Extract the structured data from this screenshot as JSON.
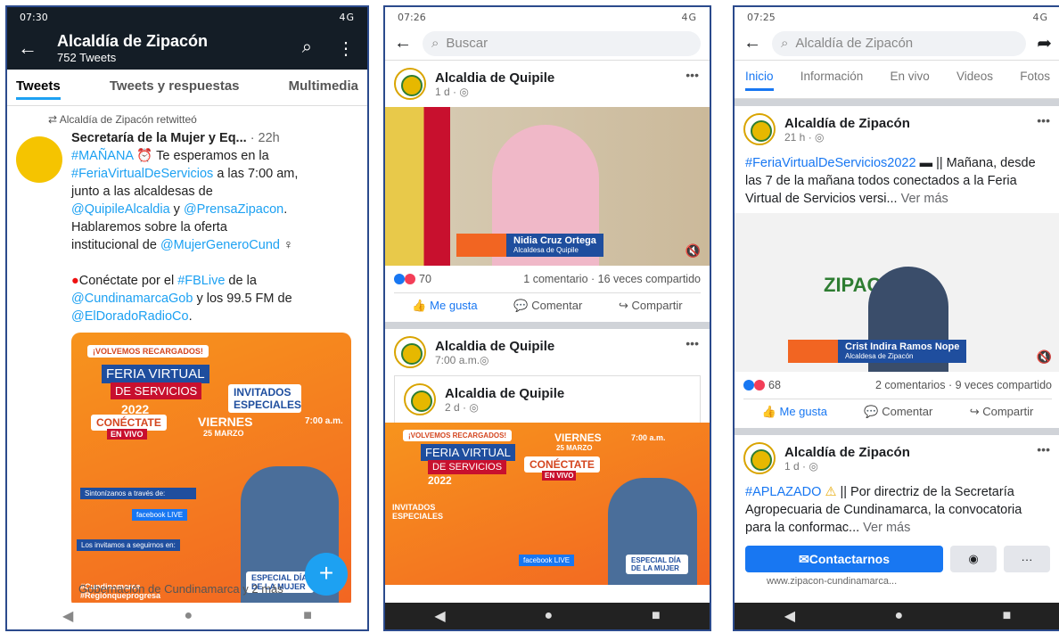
{
  "p1": {
    "status": {
      "time": "07:30",
      "icons_right": "4G"
    },
    "title": "Alcaldía de Zipacón",
    "subtitle": "752 Tweets",
    "tabs": [
      "Tweets",
      "Tweets y respuestas",
      "Multimedia"
    ],
    "retweet_label": "Alcaldía de Zipacón retwitteó",
    "tweet": {
      "author": "Secretaría de la Mujer y Eq...",
      "time": "· 22h",
      "l1_a": "#MAÑANA",
      "l1_b": " Te esperamos en la",
      "l2_a": "#FeriaVirtualDeServicios",
      "l2_b": " a las 7:00 am,",
      "l3": "junto a las alcaldesas de",
      "l4_a": "@QuipileAlcaldia",
      "l4_b": " y ",
      "l4_c": "@PrensaZipacon",
      "l4_d": ".",
      "l5": "Hablaremos sobre la oferta",
      "l6_a": "institucional de ",
      "l6_b": "@MujerGeneroCund",
      "l7_a": "Conéctate por el ",
      "l7_b": "#FBLive",
      "l7_c": " de la",
      "l8_a": "@CundinamarcaGob",
      "l8_b": " y los 99.5 FM de",
      "l9": "@ElDoradoRadioCo",
      "l9_b": "."
    },
    "poster": {
      "banner": "¡VOLVEMOS RECARGADOS!",
      "title1": "FERIA VIRTUAL",
      "title2": "DE SERVICIOS",
      "year": "2022",
      "guests": "INVITADOS ESPECIALES",
      "connect": "CONÉCTATE",
      "live": "EN VIVO",
      "day": "VIERNES",
      "date": "25 MARZO",
      "time": "7:00 a.m.",
      "sintonizanos": "Sintonízanos a través de:",
      "fb": "facebook LIVE",
      "invite": "Los invitamos a seguirnos en:",
      "hashtags": "#Cundinamarca #Regiónqueprogresa",
      "special": "ESPECIAL DÍA DE LA MUJER"
    },
    "fab": "+",
    "footer": "Gobernación de Cundinamarca y 2 más"
  },
  "p2": {
    "status": {
      "time": "07:26",
      "icons_right": "4G"
    },
    "search_placeholder": "Buscar",
    "post1": {
      "name": "Alcaldia de Quipile",
      "time": "1 d · ",
      "dots": "•••",
      "lower_name": "Nidia Cruz Ortega",
      "lower_role": "Alcaldesa de Quipile",
      "reactions": "70",
      "stats": "1 comentario · 16 veces compartido",
      "like": "Me gusta",
      "comment": "Comentar",
      "share": "Compartir"
    },
    "post2": {
      "name": "Alcaldia de Quipile",
      "time": "7:00 a.m.",
      "dots": "•••",
      "inner_name": "Alcaldia de Quipile",
      "inner_time": "2 d · ",
      "banner": "¡VOLVEMOS RECARGADOS!",
      "title1": "FERIA VIRTUAL",
      "title2": "DE SERVICIOS",
      "year": "2022",
      "day": "VIERNES",
      "date": "25 MARZO",
      "connect": "CONÉCTATE",
      "live": "EN VIVO",
      "guests": "INVITADOS ESPECIALES",
      "special": "ESPECIAL DÍA DE LA MUJER",
      "fb": "facebook LIVE"
    }
  },
  "p3": {
    "status": {
      "time": "07:25",
      "icons_right": "4G"
    },
    "search_value": "Alcaldía de Zipacón",
    "tabs": [
      "Inicio",
      "Información",
      "En vivo",
      "Videos",
      "Fotos"
    ],
    "post1": {
      "name": "Alcaldía de Zipacón",
      "time": "21 h · ",
      "dots": "•••",
      "text_a": "#FeriaVirtualDeServicios2022",
      "text_b": " || Mañana, desde las 7 de la mañana todos conectados a la Feria Virtual de Servicios versi... ",
      "more": "Ver más",
      "lower_name": "Crist Indira Ramos Nope",
      "lower_role": "Alcaldesa de Zipacón",
      "sign": "ZIPACÓN",
      "reactions": "68",
      "stats": "2 comentarios · 9 veces compartido",
      "like": "Me gusta",
      "comment": "Comentar",
      "share": "Compartir"
    },
    "post2": {
      "name": "Alcaldía de Zipacón",
      "time": "1 d · ",
      "dots": "•••",
      "text_a": "#APLAZADO",
      "text_b": " || Por directriz de la Secretaría Agropecuaria de Cundinamarca, la convocatoria para la conformac... ",
      "more": "Ver más"
    },
    "contact": "Contactarnos",
    "more_btn": "···",
    "url": "www.zipacon-cundinamarca..."
  },
  "colors": {
    "twitter_blue": "#1da1f2",
    "fb_blue": "#1877f2",
    "orange": "#f26522"
  }
}
